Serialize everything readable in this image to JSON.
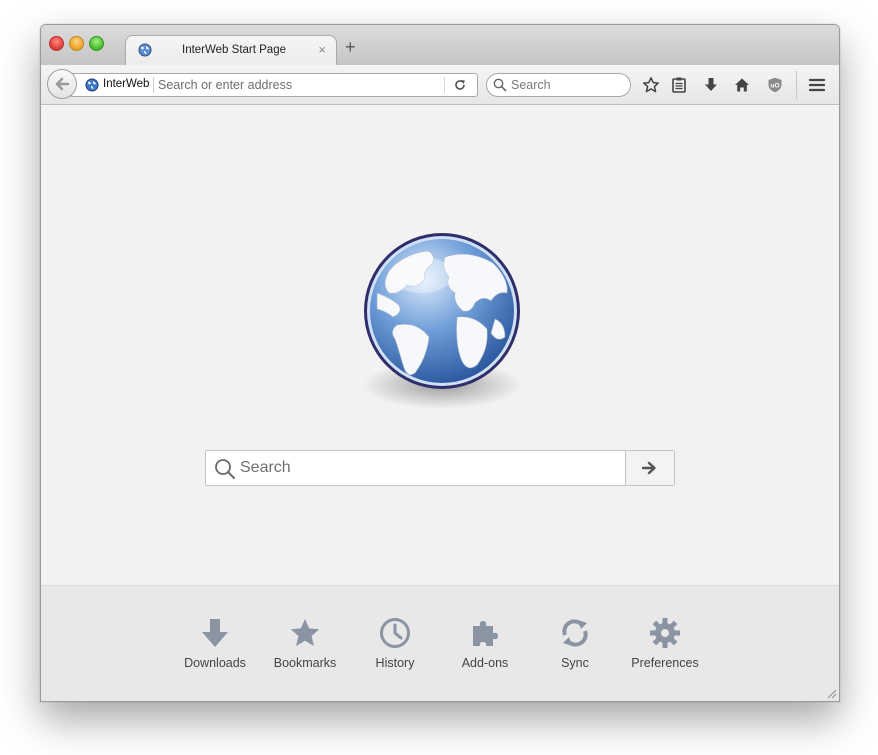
{
  "window": {
    "tab": {
      "title": "InterWeb Start Page",
      "close_glyph": "×"
    },
    "new_tab_glyph": "+"
  },
  "toolbar": {
    "identity_site": "InterWeb",
    "url_placeholder": "Search or enter address",
    "search_placeholder": "Search",
    "icons": [
      "back-arrow-icon",
      "globe-icon",
      "reload-icon",
      "search-icon",
      "star-icon",
      "reading-list-icon",
      "download-icon",
      "home-icon",
      "ublock-icon",
      "menu-icon"
    ]
  },
  "content": {
    "search_placeholder": "Search",
    "go_button_glyph": "→"
  },
  "launcher": {
    "items": [
      {
        "label": "Downloads",
        "icon": "download-icon"
      },
      {
        "label": "Bookmarks",
        "icon": "star-icon"
      },
      {
        "label": "History",
        "icon": "clock-icon"
      },
      {
        "label": "Add-ons",
        "icon": "puzzle-icon"
      },
      {
        "label": "Sync",
        "icon": "sync-icon"
      },
      {
        "label": "Preferences",
        "icon": "gear-icon"
      }
    ]
  },
  "colors": {
    "icon_gray": "#8a94a3",
    "toolbar_icon": "#4a4a4a",
    "globe_blue": "#3f78c2",
    "globe_rim": "#2f2e6b"
  }
}
